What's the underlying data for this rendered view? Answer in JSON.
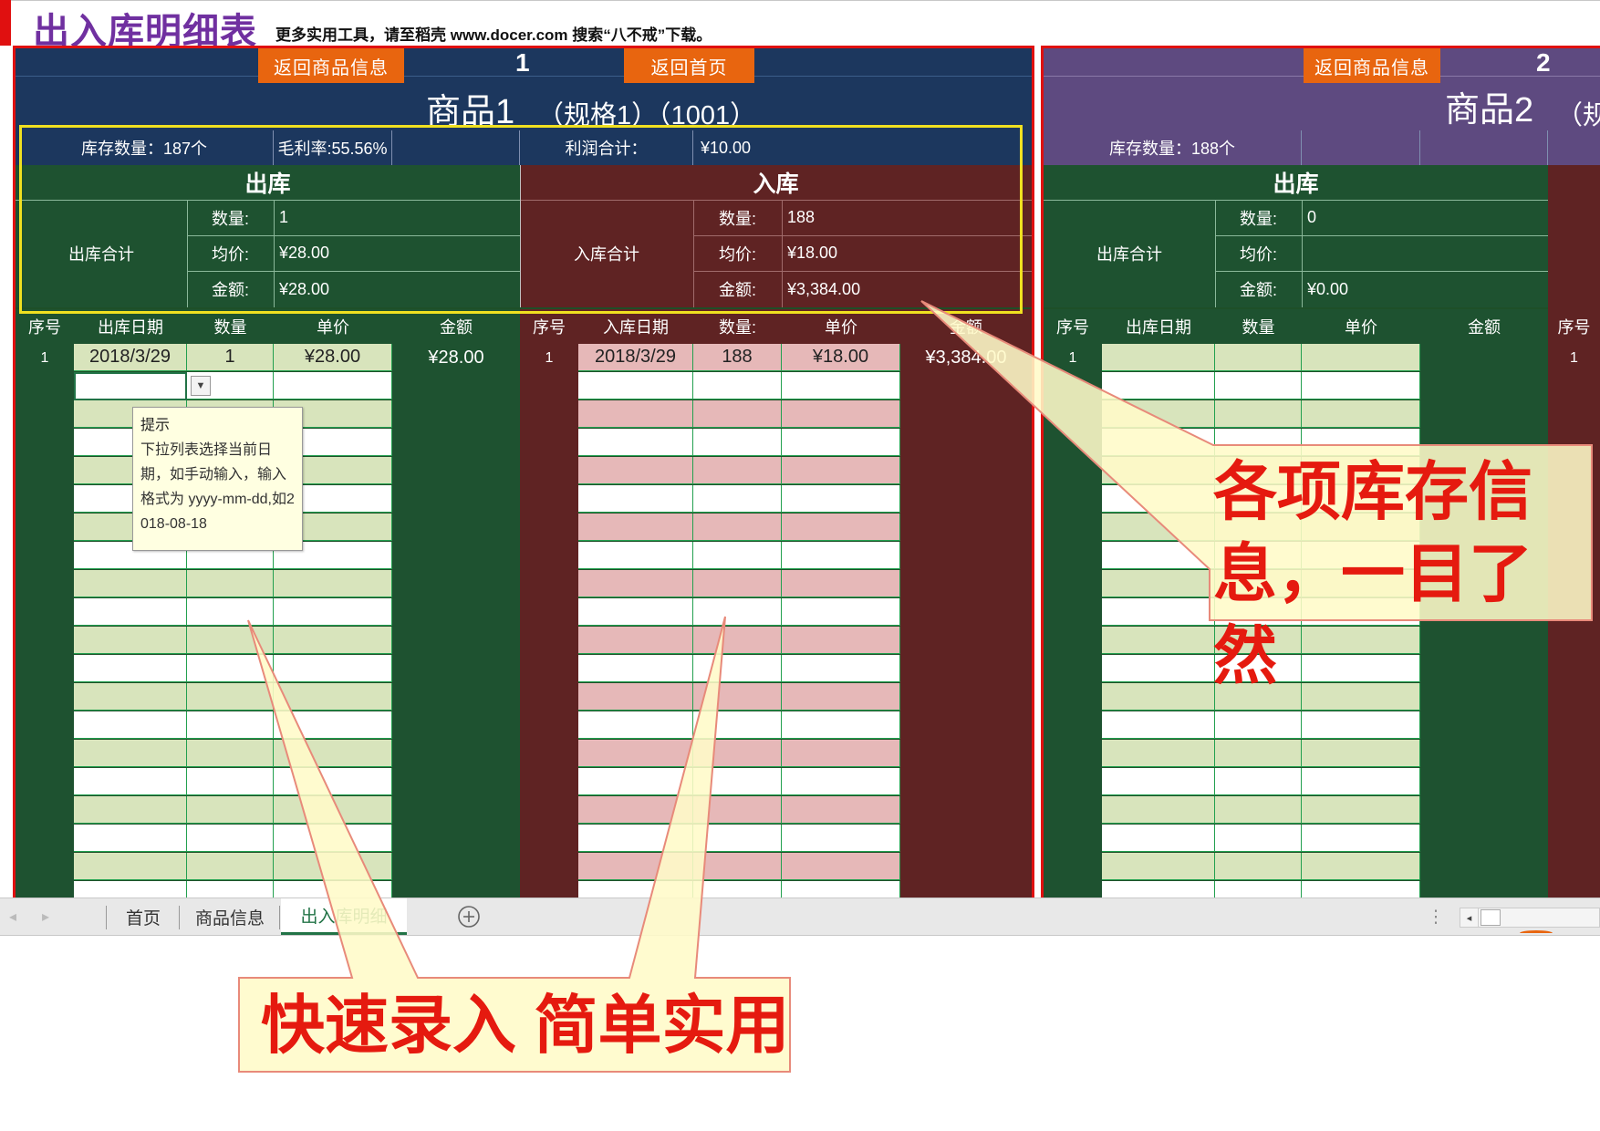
{
  "page": {
    "title": "出入库明细表",
    "tip": "更多实用工具，请至稻壳 www.docer.com 搜索“八不戒”下载。"
  },
  "panel1": {
    "number": "1",
    "btn_back_product": "返回商品信息",
    "btn_back_home": "返回首页",
    "product_name": "商品1",
    "spec": "（规格1）（1001）",
    "stock_qty": "库存数量：187个",
    "gross_margin": "毛利率:55.56%",
    "profit_label": "利润合计：",
    "profit_value": "¥10.00",
    "out": {
      "title": "出库",
      "total_label": "出库合计",
      "qty_label": "数量:",
      "qty_value": "1",
      "avg_label": "均价:",
      "avg_value": "¥28.00",
      "amount_label": "金额:",
      "amount_value": "¥28.00"
    },
    "in": {
      "title": "入库",
      "total_label": "入库合计",
      "qty_label": "数量:",
      "qty_value": "188",
      "avg_label": "均价:",
      "avg_value": "¥18.00",
      "amount_label": "金额:",
      "amount_value": "¥3,384.00"
    },
    "out_columns": [
      "序号",
      "出库日期",
      "数量",
      "单价",
      "金额"
    ],
    "in_columns": [
      "序号",
      "入库日期",
      "数量:",
      "单价",
      "金额"
    ],
    "out_rows": [
      {
        "no": "1",
        "date": "2018/3/29",
        "qty": "1",
        "price": "¥28.00",
        "amount": "¥28.00"
      }
    ],
    "in_rows": [
      {
        "no": "1",
        "date": "2018/3/29",
        "qty": "188",
        "price": "¥18.00",
        "amount": "¥3,384.00"
      }
    ]
  },
  "panel2": {
    "number": "2",
    "btn_back_product": "返回商品信息",
    "product_name": "商品2",
    "spec": "（规",
    "stock_qty": "库存数量：188个",
    "out": {
      "title": "出库",
      "total_label": "出库合计",
      "qty_label": "数量:",
      "qty_value": "0",
      "avg_label": "均价:",
      "avg_value": "",
      "amount_label": "金额:",
      "amount_value": "¥0.00"
    },
    "out_columns": [
      "序号",
      "出库日期",
      "数量",
      "单价",
      "金额"
    ],
    "in_first_column": "序号",
    "in_row_no": "1"
  },
  "tooltip": {
    "title": "提示",
    "body": "下拉列表选择当前日期，如手动输入，输入格式为 yyyy-mm-dd,如2018-08-18"
  },
  "tabs": {
    "items": [
      "首页",
      "商品信息",
      "出入库明细"
    ],
    "active": "出入库明细"
  },
  "callouts": {
    "top_right": "各项库存信息，一目了然",
    "bottom": "快速录入 简单实用"
  },
  "colors": {
    "title_purple": "#7030a0",
    "header_navy": "#1c375e",
    "header_purple": "#5e4a80",
    "out_green": "#1e5230",
    "in_maroon": "#5f2323",
    "row_green": "#d8e4bc",
    "row_pink": "#e6b8b8",
    "button_orange": "#e8650f",
    "border_red": "#e01010",
    "highlight_yellow": "#f0e020",
    "callout_text_red": "#e51a0f",
    "callout_fill": "#fffbc8"
  }
}
